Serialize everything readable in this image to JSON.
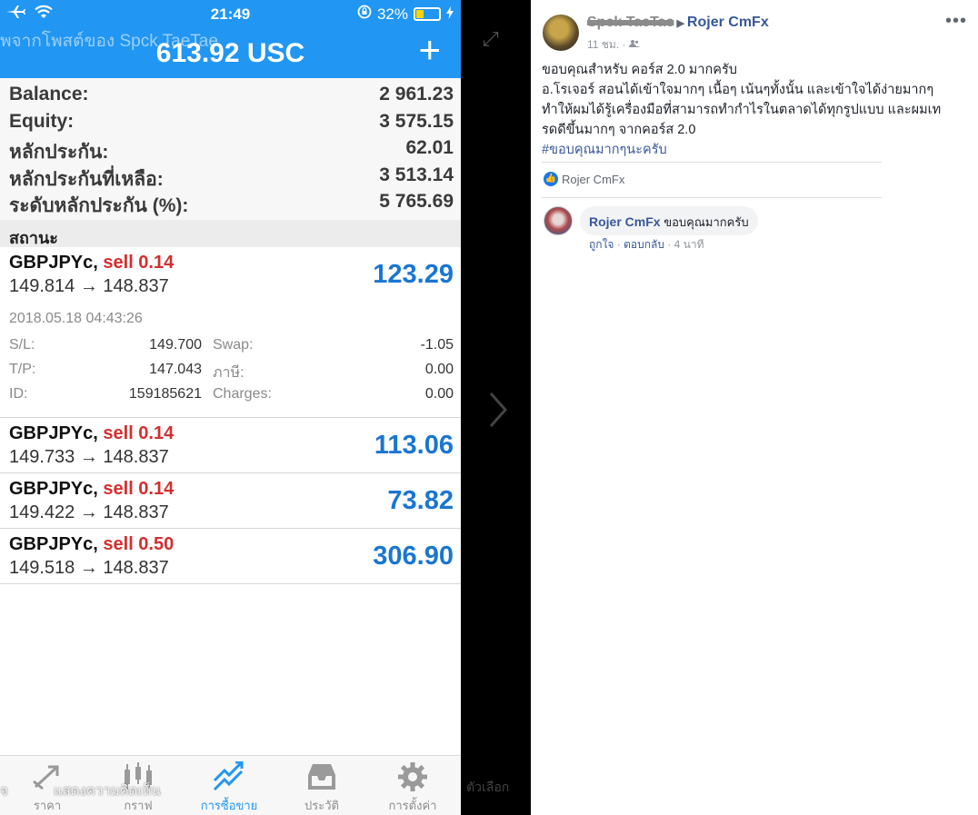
{
  "status_bar": {
    "time": "21:49",
    "battery": "32%",
    "battery_fraction": 0.32
  },
  "header": {
    "overlay_text": "ิพจากโพสต์ของ Spck TaeTae",
    "title": "613.92 USC",
    "add_icon": "plus-icon"
  },
  "summary": [
    {
      "label": "Balance:",
      "value": "2 961.23"
    },
    {
      "label": "Equity:",
      "value": "3 575.15"
    },
    {
      "label": "หลักประกัน:",
      "value": "62.01"
    },
    {
      "label": "หลักประกันที่เหลือ:",
      "value": "3 513.14"
    },
    {
      "label": "ระดับหลักประกัน (%):",
      "value": "5 765.69"
    }
  ],
  "section_title": "สถานะ",
  "positions": [
    {
      "symbol": "GBPJPYc,",
      "side": "sell 0.14",
      "prices": "149.814 → 148.837",
      "profit": "123.29",
      "expanded": true,
      "datetime": "2018.05.18 04:43:26",
      "details": [
        {
          "label": "S/L:",
          "value": "149.700",
          "label2": "Swap:",
          "value2": "-1.05"
        },
        {
          "label": "T/P:",
          "value": "147.043",
          "label2": "ภาษี:",
          "value2": "0.00"
        },
        {
          "label": "ID:",
          "value": "159185621",
          "label2": "Charges:",
          "value2": "0.00"
        }
      ]
    },
    {
      "symbol": "GBPJPYc,",
      "side": "sell 0.14",
      "prices": "149.733 → 148.837",
      "profit": "113.06"
    },
    {
      "symbol": "GBPJPYc,",
      "side": "sell 0.14",
      "prices": "149.422 → 148.837",
      "profit": "73.82"
    },
    {
      "symbol": "GBPJPYc,",
      "side": "sell 0.50",
      "prices": "149.518 → 148.837",
      "profit": "306.90"
    }
  ],
  "tabs": [
    {
      "label": "ราคา",
      "icon": "quotes-icon",
      "active": false
    },
    {
      "label": "กราฟ",
      "icon": "chart-icon",
      "active": false
    },
    {
      "label": "การซื้อขาย",
      "icon": "trade-icon",
      "active": true
    },
    {
      "label": "ประวัติ",
      "icon": "history-icon",
      "active": false
    },
    {
      "label": "การตั้งค่า",
      "icon": "settings-icon",
      "active": false
    }
  ],
  "overlay_bottom": {
    "left_text": "จ",
    "comment_text": "แสดงความคิดเห็น",
    "options_text": "ตัวเลือก"
  },
  "facebook": {
    "author": "Spck TaeTae",
    "page": "Rojer CmFx",
    "time": "11 ชม. ·",
    "post_lines": [
      "ขอบคุณสำหรับ คอร์ส 2.0 มากครับ",
      "อ.โรเจอร์ สอนได้เข้าใจมากๆ เนื้อๆ เน้นๆทั้งนั้น และเข้าใจได้ง่ายมากๆ",
      "ทำให้ผมได้รู้เครื่องมือที่สามารถทำกำไรในตลาดได้ทุกรูปแบบ และผมเท",
      "รดดีขึ้นมากๆ จากคอร์ส 2.0"
    ],
    "hashtag": "#ขอบคุณมากๆนะครับ",
    "like_name": "Rojer CmFx",
    "comment": {
      "name": "Rojer CmFx",
      "text": "ขอบคุณมากครับ",
      "like": "ถูกใจ",
      "reply": "ตอบกลับ",
      "time": "4 นาที"
    }
  },
  "colors": {
    "accent": "#2196f3",
    "profit": "#1976d2",
    "sell": "#d32f2f",
    "fb_link": "#385898"
  }
}
